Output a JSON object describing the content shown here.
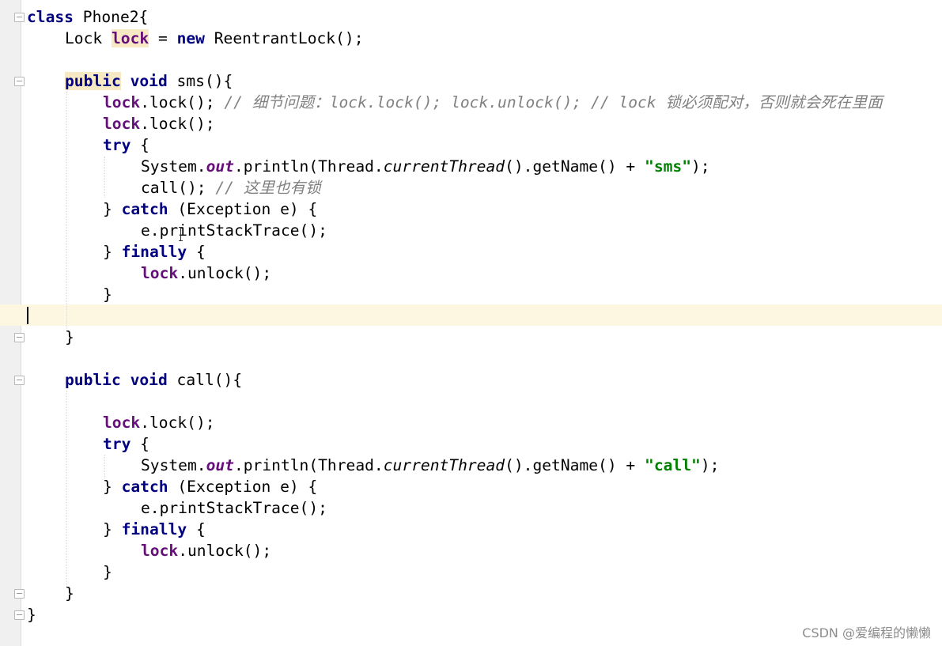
{
  "editor": {
    "class_decl": {
      "kw": "class",
      "name": " Phone2{"
    },
    "field_decl": {
      "type": "Lock ",
      "name": "lock",
      "eq": " = ",
      "new": "new",
      "ctor": " ReentrantLock();"
    },
    "sms": {
      "decl": {
        "public": "public",
        "void": " void",
        "sig": " sms(){"
      },
      "l1": {
        "recv": "lock",
        "call": ".lock(); ",
        "comment": "// 细节问题：lock.lock(); lock.unlock(); // lock 锁必须配对，否则就会死在里面"
      },
      "l2": {
        "recv": "lock",
        "call": ".lock();"
      },
      "try": {
        "kw": "try",
        "rest": " {"
      },
      "print": {
        "sys": "System.",
        "out": "out",
        "mid": ".println(Thread.",
        "ct": "currentThread",
        "mid2": "().getName() + ",
        "str": "\"sms\"",
        "end": ");"
      },
      "callline": {
        "code": "call(); ",
        "comment": "// 这里也有锁"
      },
      "catch": {
        "pre": "} ",
        "kw": "catch",
        "rest": " (Exception e) {"
      },
      "trace": "e.printStackTrace();",
      "finally": {
        "pre": "} ",
        "kw": "finally",
        "rest": " {"
      },
      "unlock": {
        "recv": "lock",
        "call": ".unlock();"
      },
      "close_inner": "}",
      "close": "}"
    },
    "call": {
      "decl": {
        "public": "public",
        "void": " void",
        "sig": " call(){"
      },
      "l1": {
        "recv": "lock",
        "call": ".lock();"
      },
      "try": {
        "kw": "try",
        "rest": " {"
      },
      "print": {
        "sys": "System.",
        "out": "out",
        "mid": ".println(Thread.",
        "ct": "currentThread",
        "mid2": "().getName() + ",
        "str": "\"call\"",
        "end": ");"
      },
      "catch": {
        "pre": "} ",
        "kw": "catch",
        "rest": " (Exception e) {"
      },
      "trace": "e.printStackTrace();",
      "finally": {
        "pre": "} ",
        "kw": "finally",
        "rest": " {"
      },
      "unlock": {
        "recv": "lock",
        "call": ".unlock();"
      },
      "close_inner": "}",
      "close": "}"
    },
    "class_close": "}"
  },
  "watermark": "CSDN @爱编程的懒懒",
  "colors": {
    "keyword": "#000080",
    "field": "#660e7a",
    "string": "#008000",
    "comment": "#808080",
    "caret_row": "#fdf6e0",
    "highlight": "#f7e9c4"
  }
}
